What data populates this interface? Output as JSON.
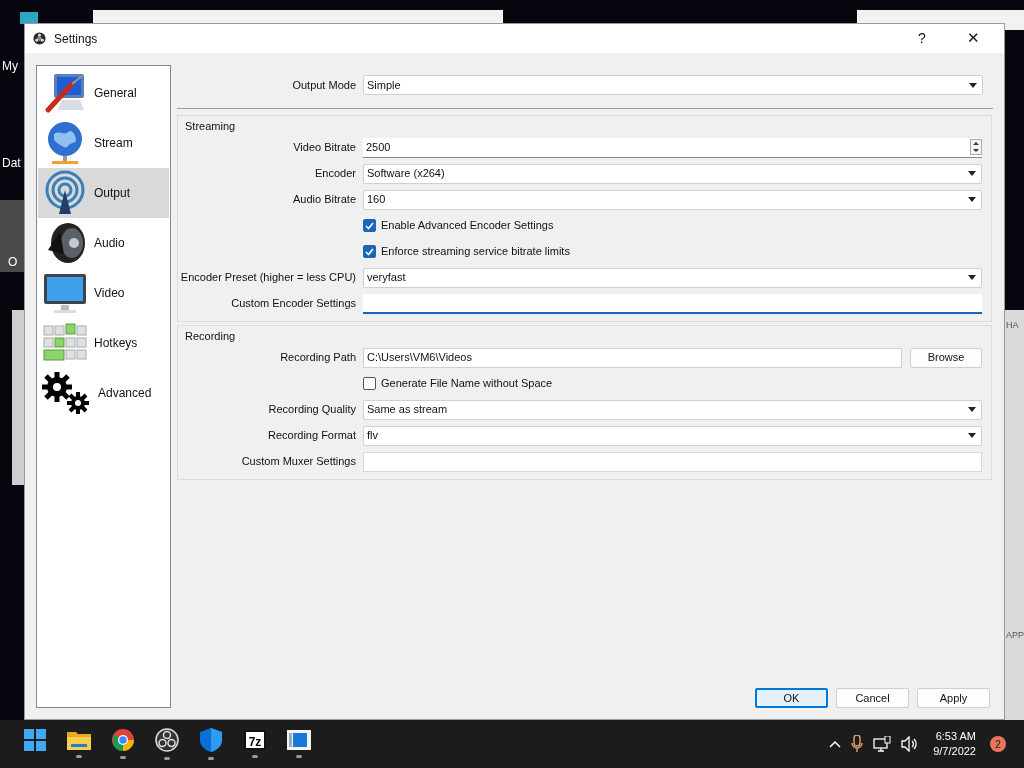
{
  "desktop": {
    "left_labels": [
      "My",
      "Dat",
      "O"
    ],
    "right_labels": [
      "HA",
      "APP"
    ]
  },
  "window": {
    "title": "Settings",
    "help": "?",
    "close": "✕"
  },
  "sidebar": {
    "items": [
      {
        "label": "General",
        "selected": false
      },
      {
        "label": "Stream",
        "selected": false
      },
      {
        "label": "Output",
        "selected": true
      },
      {
        "label": "Audio",
        "selected": false
      },
      {
        "label": "Video",
        "selected": false
      },
      {
        "label": "Hotkeys",
        "selected": false
      },
      {
        "label": "Advanced",
        "selected": false
      }
    ]
  },
  "output_mode": {
    "label": "Output Mode",
    "value": "Simple"
  },
  "streaming": {
    "title": "Streaming",
    "fields": [
      {
        "kind": "spin",
        "label": "Video Bitrate",
        "value": "2500"
      },
      {
        "kind": "select",
        "label": "Encoder",
        "value": "Software (x264)"
      },
      {
        "kind": "select",
        "label": "Audio Bitrate",
        "value": "160"
      },
      {
        "kind": "checkbox",
        "label": "Enable Advanced Encoder Settings",
        "checked": true
      },
      {
        "kind": "checkbox",
        "label": "Enforce streaming service bitrate limits",
        "checked": true
      },
      {
        "kind": "select",
        "label": "Encoder Preset (higher = less CPU)",
        "value": "veryfast"
      },
      {
        "kind": "text",
        "label": "Custom Encoder Settings",
        "focused": true
      }
    ]
  },
  "recording": {
    "title": "Recording",
    "fields": [
      {
        "kind": "path",
        "label": "Recording Path",
        "value": "C:\\Users\\VM6\\Videos",
        "button": "Browse"
      },
      {
        "kind": "checkbox",
        "label": "Generate File Name without Space",
        "checked": false
      },
      {
        "kind": "select",
        "label": "Recording Quality",
        "value": "Same as stream"
      },
      {
        "kind": "select",
        "label": "Recording Format",
        "value": "flv"
      },
      {
        "kind": "text",
        "label": "Custom Muxer Settings",
        "focused": false
      }
    ]
  },
  "buttons": [
    {
      "label": "OK",
      "default": true
    },
    {
      "label": "Cancel",
      "default": false
    },
    {
      "label": "Apply",
      "default": false
    }
  ],
  "taskbar": {
    "app_7z": "7z",
    "time": "6:53 AM",
    "date": "9/7/2022",
    "notifications": "2"
  }
}
